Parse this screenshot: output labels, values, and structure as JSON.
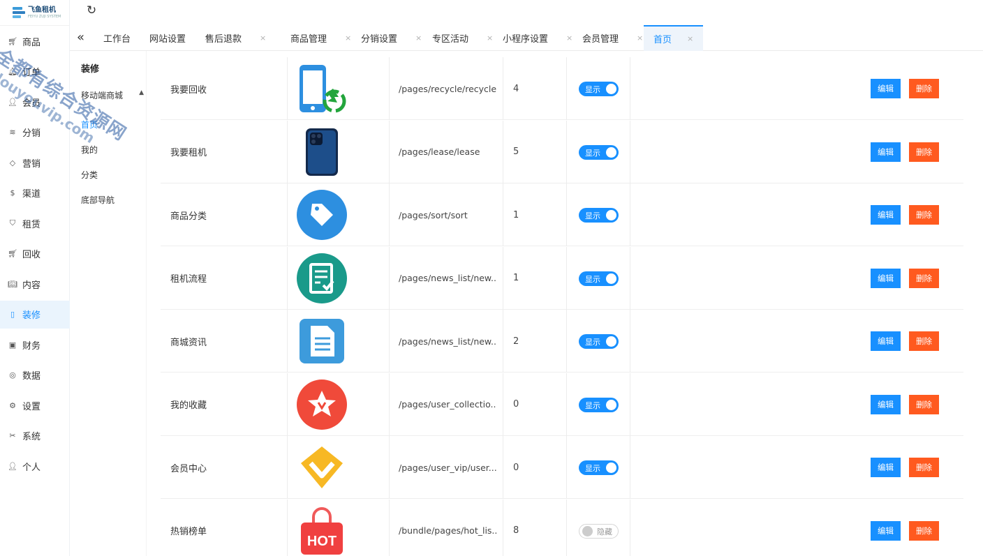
{
  "app": {
    "logo_name": "飞鱼租机",
    "logo_sub": "FEIYU ZUJI SYSTEM"
  },
  "sidebar": {
    "items": [
      {
        "label": "商品",
        "icon": "cart-icon"
      },
      {
        "label": "订单",
        "icon": "bell-icon"
      },
      {
        "label": "会员",
        "icon": "user-icon"
      },
      {
        "label": "分销",
        "icon": "layers-icon"
      },
      {
        "label": "营销",
        "icon": "diamond-icon"
      },
      {
        "label": "渠道",
        "icon": "coin-icon"
      },
      {
        "label": "租赁",
        "icon": "shield-icon"
      },
      {
        "label": "回收",
        "icon": "cart-icon"
      },
      {
        "label": "内容",
        "icon": "book-icon"
      },
      {
        "label": "装修",
        "icon": "tablet-icon"
      },
      {
        "label": "财务",
        "icon": "wallet-icon"
      },
      {
        "label": "数据",
        "icon": "chart-icon"
      },
      {
        "label": "设置",
        "icon": "gear-icon"
      },
      {
        "label": "系统",
        "icon": "tools-icon"
      },
      {
        "label": "个人",
        "icon": "person-icon"
      }
    ],
    "active_index": 9
  },
  "subnav": {
    "title": "装修",
    "group": "移动端商城",
    "items": [
      "首页",
      "我的",
      "分类",
      "底部导航"
    ],
    "active_index": 0
  },
  "tabs": [
    {
      "label": "工作台",
      "closable": false
    },
    {
      "label": "网站设置",
      "closable": true
    },
    {
      "label": "售后退款",
      "closable": true
    },
    {
      "label": "商品管理",
      "closable": true
    },
    {
      "label": "分销设置",
      "closable": true
    },
    {
      "label": "专区活动",
      "closable": true
    },
    {
      "label": "小程序设置",
      "closable": true
    },
    {
      "label": "会员管理",
      "closable": true
    },
    {
      "label": "首页",
      "closable": true,
      "active": true
    }
  ],
  "tab_close_glyph": "×",
  "table": {
    "edit_label": "编辑",
    "delete_label": "删除",
    "rows": [
      {
        "name": "我要回收",
        "icon": "phone-recycle-icon",
        "path": "/pages/recycle/recycle",
        "sort": "4",
        "status": "显示",
        "visible": true
      },
      {
        "name": "我要租机",
        "icon": "smartphone-icon",
        "path": "/pages/lease/lease",
        "sort": "5",
        "status": "显示",
        "visible": true
      },
      {
        "name": "商品分类",
        "icon": "tag-icon",
        "path": "/pages/sort/sort",
        "sort": "1",
        "status": "显示",
        "visible": true
      },
      {
        "name": "租机流程",
        "icon": "checklist-icon",
        "path": "/pages/news_list/new...",
        "sort": "1",
        "status": "显示",
        "visible": true
      },
      {
        "name": "商城资讯",
        "icon": "document-icon",
        "path": "/pages/news_list/new...",
        "sort": "2",
        "status": "显示",
        "visible": true
      },
      {
        "name": "我的收藏",
        "icon": "star-icon",
        "path": "/pages/user_collectio...",
        "sort": "0",
        "status": "显示",
        "visible": true
      },
      {
        "name": "会员中心",
        "icon": "vip-diamond-icon",
        "path": "/pages/user_vip/user...",
        "sort": "0",
        "status": "显示",
        "visible": true
      },
      {
        "name": "热销榜单",
        "icon": "hot-bag-icon",
        "path": "/bundle/pages/hot_lis...",
        "sort": "8",
        "status": "隐藏",
        "visible": false
      }
    ]
  },
  "watermark": {
    "line1": "全都有综合资源网",
    "line2": "douyouvip.com"
  },
  "colors": {
    "primary": "#1890ff",
    "danger": "#ff5a1f"
  }
}
